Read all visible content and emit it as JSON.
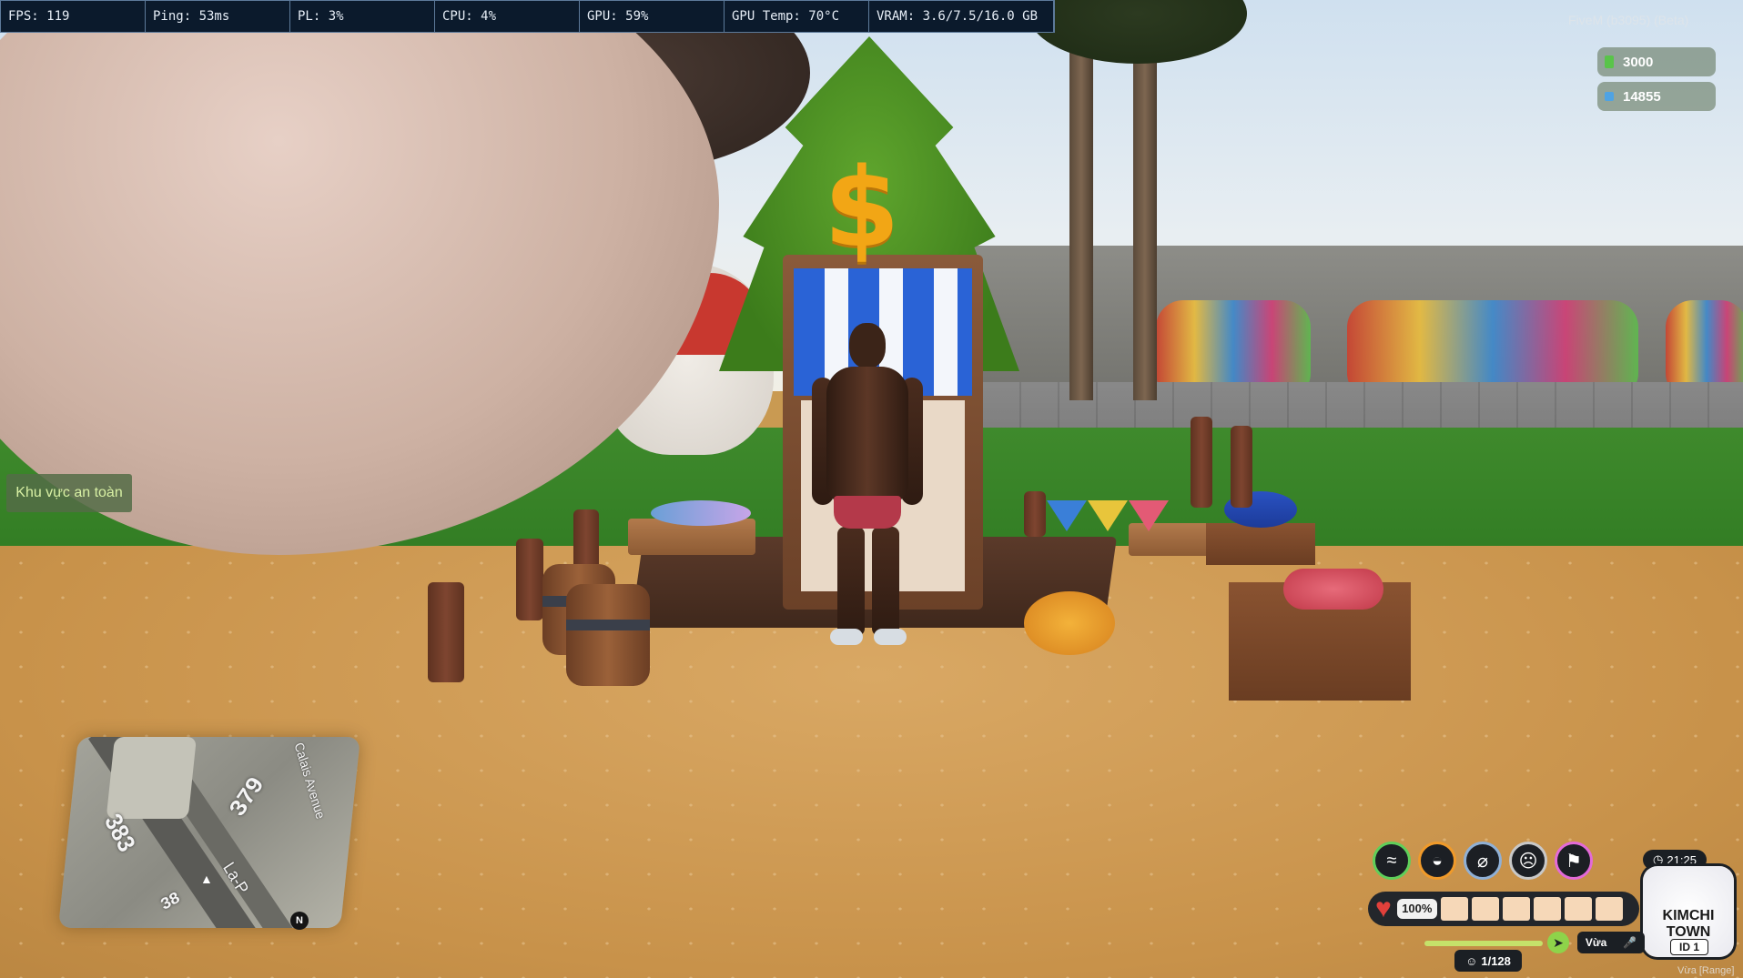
{
  "perf": {
    "fps": "FPS: 119",
    "ping": "Ping: 53ms",
    "pl": "PL: 3%",
    "cpu": "CPU: 4%",
    "gpu": "GPU: 59%",
    "gpu_temp": "GPU Temp: 70°C",
    "vram": "VRAM: 3.6/7.5/16.0 GB"
  },
  "watermark": "FiveM (b3095) (Beta)",
  "money": {
    "cash": "3000",
    "bank": "14855",
    "cash_color": "#59c44a",
    "bank_color": "#4fa3e3"
  },
  "shop_marker": "$",
  "zone_label": "Khu vực an toàn",
  "minimap": {
    "block_a": "383",
    "block_b": "379",
    "block_c": "38",
    "street_a": "Calais Avenue",
    "street_b": "La-P",
    "compass": "N",
    "player_blip": "player-arrow-icon"
  },
  "status": {
    "icons": [
      "swim-icon",
      "hunger-icon",
      "thirst-icon",
      "stress-icon",
      "armor-icon"
    ],
    "clock": "21:25",
    "health_pct": "100%",
    "voice_mode": "Vừa",
    "players": "1/128",
    "range_text": "Vừa [Range]",
    "logo_line1": "KIMCHI",
    "logo_line2": "TOWN",
    "logo_id": "ID 1"
  }
}
